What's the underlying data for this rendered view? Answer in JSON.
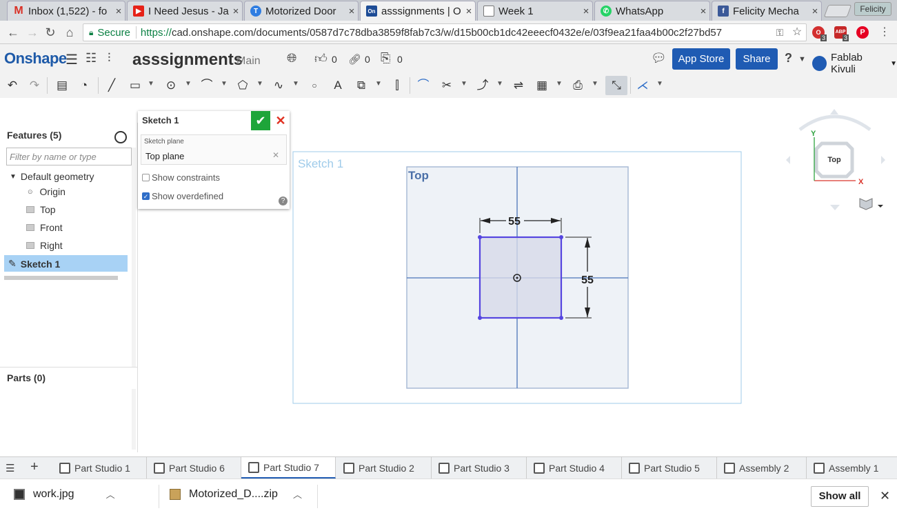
{
  "browser": {
    "tabs": [
      {
        "label": "Inbox (1,522) - fo",
        "icon": "gmail-icon",
        "color": "#d93025"
      },
      {
        "label": "I Need Jesus - Ja",
        "icon": "youtube-icon",
        "color": "#e62117"
      },
      {
        "label": "Motorized Door",
        "icon": "instructables-icon",
        "color": "#2f7de1"
      },
      {
        "label": "asssignments | O",
        "icon": "onshape-icon",
        "color": "#1e4c96"
      },
      {
        "label": "Week 1",
        "icon": "document-icon",
        "color": "#777777"
      },
      {
        "label": "WhatsApp",
        "icon": "whatsapp-icon",
        "color": "#25d366"
      },
      {
        "label": "Felicity Mecha",
        "icon": "facebook-icon",
        "color": "#3b5998"
      }
    ],
    "profile": "Felicity",
    "secure_label": "Secure",
    "url_scheme": "https://",
    "url_rest": "cad.onshape.com/documents/0587d7c78dba3859f8fab7c3/w/d15b00cb1dc42eeecf0432e/e/03f9ea21faa4b00c2f27bd57",
    "ext_badge_1": "3",
    "ext_badge_2": "3"
  },
  "header": {
    "logo": "Onshape",
    "doc_title": "asssignments",
    "branch": "Main",
    "likes": "0",
    "links": "0",
    "copies": "0",
    "app_store": "App Store",
    "share": "Share",
    "user": "Fablab Kivuli"
  },
  "features": {
    "title": "Features (5)",
    "filter_placeholder": "Filter by name or type",
    "default_geometry": "Default geometry",
    "items": [
      "Origin",
      "Top",
      "Front",
      "Right"
    ],
    "selected": "Sketch 1",
    "parts_title": "Parts (0)"
  },
  "sketch_dialog": {
    "title": "Sketch 1",
    "plane_label": "Sketch plane",
    "plane_value": "Top plane",
    "show_constraints": "Show constraints",
    "show_overdefined": "Show overdefined",
    "help": "?"
  },
  "viewport": {
    "sketch_label": "Sketch 1",
    "plane_label": "Top",
    "dim_width": "55",
    "dim_height": "55",
    "view_cube_label": "Top",
    "axis_x": "X",
    "axis_y": "Y"
  },
  "bottom_tabs": [
    "Part Studio 1",
    "Part Studio 6",
    "Part Studio 7",
    "Part Studio 2",
    "Part Studio 3",
    "Part Studio 4",
    "Part Studio 5",
    "Assembly 2",
    "Assembly 1"
  ],
  "downloads": {
    "items": [
      "work.jpg",
      "Motorized_D....zip"
    ],
    "show_all": "Show all"
  }
}
